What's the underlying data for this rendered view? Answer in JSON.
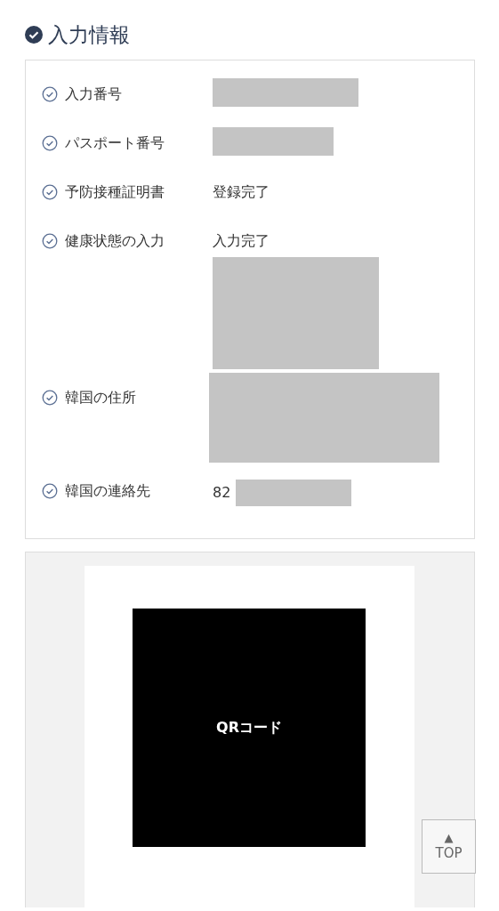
{
  "section": {
    "title": "入力情報"
  },
  "fields": [
    {
      "label": "入力番号",
      "kind": "long"
    },
    {
      "label": "パスポート番号",
      "kind": "short"
    },
    {
      "label": "予防接種証明書",
      "value": "登録完了",
      "kind": "plain"
    },
    {
      "label": "健康状態の入力",
      "value": "入力完了",
      "kind": "below"
    },
    {
      "label": "韓国の住所",
      "kind": "wide"
    },
    {
      "label": "韓国の連絡先",
      "value": "82",
      "kind": "inline"
    }
  ],
  "qr": {
    "caption": "QRコード"
  },
  "top_button": {
    "arrow": "▲",
    "label": "TOP"
  }
}
